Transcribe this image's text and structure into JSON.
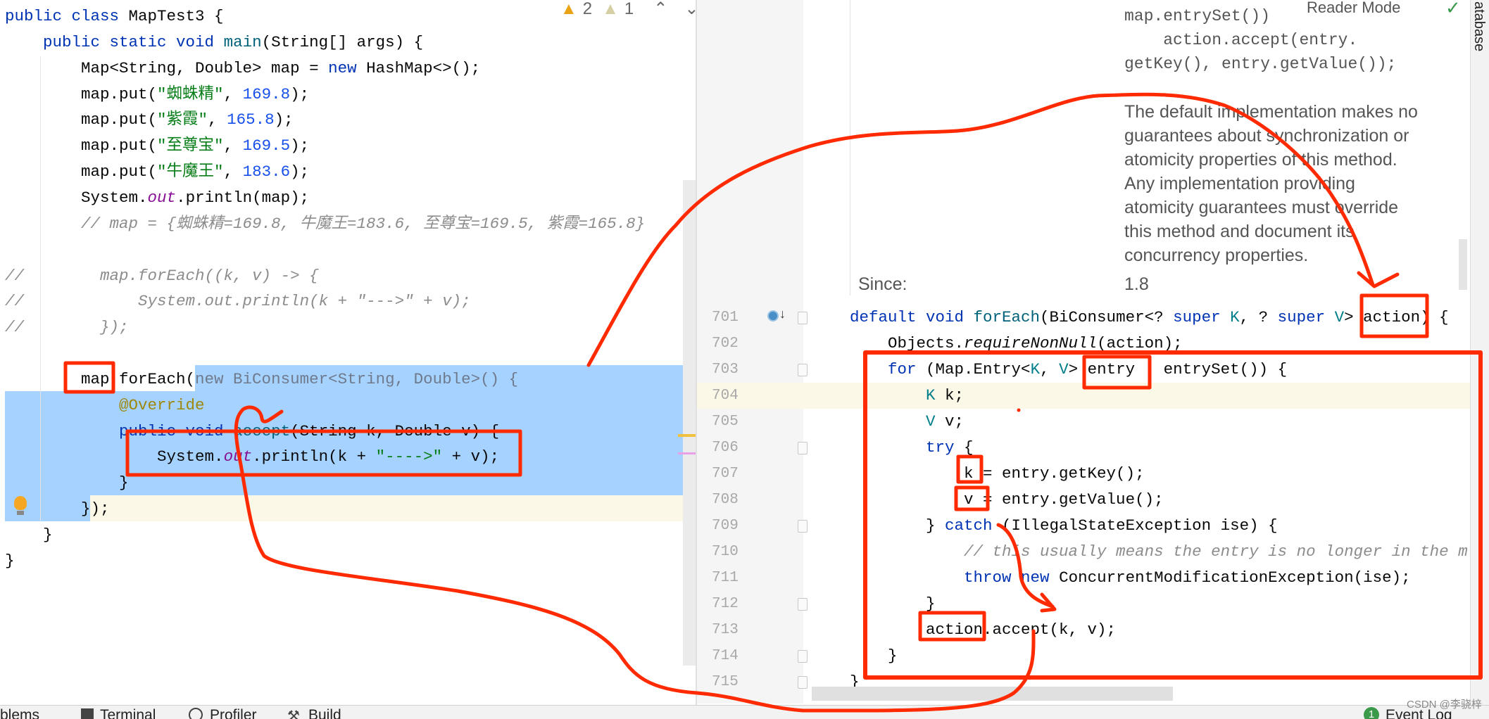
{
  "editor_left": {
    "inspection": {
      "warnings": "2",
      "weak_warnings": "1",
      "prev_icon": "chevron-up-icon",
      "next_icon": "chevron-down-icon"
    },
    "lines": [
      {
        "tokens": [
          [
            "public class ",
            "k"
          ],
          [
            "MapTest3 {",
            "p"
          ]
        ]
      },
      {
        "tokens": [
          [
            "    public static void ",
            "k"
          ],
          [
            "main",
            "m"
          ],
          [
            "(String[] args) {",
            "p"
          ]
        ]
      },
      {
        "tokens": [
          [
            "        Map<String, Double> map = ",
            "p"
          ],
          [
            "new ",
            "k"
          ],
          [
            "HashMap<>();",
            "p"
          ]
        ]
      },
      {
        "tokens": [
          [
            "        map.put(",
            "p"
          ],
          [
            "\"蜘蛛精\"",
            "s"
          ],
          [
            ", ",
            "p"
          ],
          [
            "169.8",
            "n"
          ],
          [
            ");",
            "p"
          ]
        ]
      },
      {
        "tokens": [
          [
            "        map.put(",
            "p"
          ],
          [
            "\"紫霞\"",
            "s"
          ],
          [
            ", ",
            "p"
          ],
          [
            "165.8",
            "n"
          ],
          [
            ");",
            "p"
          ]
        ]
      },
      {
        "tokens": [
          [
            "        map.put(",
            "p"
          ],
          [
            "\"至尊宝\"",
            "s"
          ],
          [
            ", ",
            "p"
          ],
          [
            "169.5",
            "n"
          ],
          [
            ");",
            "p"
          ]
        ]
      },
      {
        "tokens": [
          [
            "        map.put(",
            "p"
          ],
          [
            "\"牛魔王\"",
            "s"
          ],
          [
            ", ",
            "p"
          ],
          [
            "183.6",
            "n"
          ],
          [
            ");",
            "p"
          ]
        ]
      },
      {
        "tokens": [
          [
            "        System.",
            "p"
          ],
          [
            "out",
            "f"
          ],
          [
            ".println(map);",
            "p"
          ]
        ]
      },
      {
        "tokens": [
          [
            "        // map = {蜘蛛精=169.8, 牛魔王=183.6, 至尊宝=169.5, 紫霞=165.8}",
            "c"
          ]
        ]
      },
      {
        "tokens": []
      },
      {
        "tokens": [
          [
            "//        map.forEach((k, v) -> {",
            "c"
          ]
        ]
      },
      {
        "tokens": [
          [
            "//            System.out.println(k + \"--->\" + v);",
            "c"
          ]
        ]
      },
      {
        "tokens": [
          [
            "//        });",
            "c"
          ]
        ]
      },
      {
        "tokens": []
      },
      {
        "tokens": [
          [
            "        map.forEach(",
            "p"
          ],
          [
            "new BiConsumer<String, Double>() {",
            "g"
          ]
        ]
      },
      {
        "tokens": [
          [
            "            @Override",
            "a"
          ]
        ]
      },
      {
        "tokens": [
          [
            "            public void ",
            "k"
          ],
          [
            "accept",
            "m"
          ],
          [
            "(String k, Double v) {",
            "p"
          ]
        ]
      },
      {
        "tokens": [
          [
            "                System.",
            "p"
          ],
          [
            "out",
            "f"
          ],
          [
            ".println(k + ",
            "p"
          ],
          [
            "\"---->\"",
            "s"
          ],
          [
            " + v);",
            "p"
          ]
        ]
      },
      {
        "tokens": [
          [
            "            }",
            "p"
          ]
        ]
      },
      {
        "tokens": [
          [
            "        });",
            "p"
          ]
        ]
      },
      {
        "tokens": [
          [
            "    }",
            "p"
          ]
        ]
      },
      {
        "tokens": [
          [
            "}",
            "p"
          ]
        ]
      }
    ]
  },
  "doc_popup": {
    "reader_mode_label": "Reader Mode",
    "code_lines": [
      "map.entrySet())",
      "    action.accept(entry.",
      "getKey(), entry.getValue());"
    ],
    "paragraph_lines": [
      "The default implementation makes no",
      "guarantees about synchronization or",
      "atomicity properties of this method.",
      "Any implementation providing",
      "atomicity guarantees must override",
      "this method and document its",
      "concurrency properties."
    ],
    "since_label": "Since:",
    "since_value": "1.8"
  },
  "editor_right": {
    "lines": [
      {
        "num": "701",
        "tokens": [
          [
            "default void ",
            "k"
          ],
          [
            "forEach",
            "m"
          ],
          [
            "(BiConsumer<? ",
            "p"
          ],
          [
            "super ",
            "k"
          ],
          [
            "K",
            "t"
          ],
          [
            ", ? ",
            "p"
          ],
          [
            "super ",
            "k"
          ],
          [
            "V",
            "t"
          ],
          [
            "> action) {",
            "p"
          ]
        ]
      },
      {
        "num": "702",
        "tokens": [
          [
            "    Objects.",
            "p"
          ],
          [
            "requireNonNull",
            "i"
          ],
          [
            "(action);",
            "p"
          ]
        ]
      },
      {
        "num": "703",
        "tokens": [
          [
            "    for ",
            "k"
          ],
          [
            "(Map.Entry<",
            "p"
          ],
          [
            "K",
            "t"
          ],
          [
            ", ",
            "p"
          ],
          [
            "V",
            "t"
          ],
          [
            "> entry : entrySet()) {",
            "p"
          ]
        ]
      },
      {
        "num": "704",
        "tokens": [
          [
            "        K ",
            "t"
          ],
          [
            "k;",
            "p"
          ]
        ]
      },
      {
        "num": "705",
        "tokens": [
          [
            "        V ",
            "t"
          ],
          [
            "v;",
            "p"
          ]
        ]
      },
      {
        "num": "706",
        "tokens": [
          [
            "        try ",
            "k"
          ],
          [
            "{",
            "p"
          ]
        ]
      },
      {
        "num": "707",
        "tokens": [
          [
            "            k = entry.getKey();",
            "p"
          ]
        ]
      },
      {
        "num": "708",
        "tokens": [
          [
            "            v = entry.getValue();",
            "p"
          ]
        ]
      },
      {
        "num": "709",
        "tokens": [
          [
            "        } ",
            "p"
          ],
          [
            "catch ",
            "k"
          ],
          [
            "(IllegalStateException ise) {",
            "p"
          ]
        ]
      },
      {
        "num": "710",
        "tokens": [
          [
            "            // this usually means the entry is no longer in the m",
            "c"
          ]
        ]
      },
      {
        "num": "711",
        "tokens": [
          [
            "            throw new ",
            "k"
          ],
          [
            "ConcurrentModificationException(ise);",
            "p"
          ]
        ]
      },
      {
        "num": "712",
        "tokens": [
          [
            "        }",
            "p"
          ]
        ]
      },
      {
        "num": "713",
        "tokens": [
          [
            "        action.accept(k, v);",
            "p"
          ]
        ]
      },
      {
        "num": "714",
        "tokens": [
          [
            "    }",
            "p"
          ]
        ]
      },
      {
        "num": "715",
        "tokens": [
          [
            "}",
            "p"
          ]
        ]
      }
    ]
  },
  "side_tab": {
    "label": "atabase"
  },
  "bottom_bar": {
    "items": [
      {
        "label": "blems",
        "icon": "problems-icon"
      },
      {
        "label": "Terminal",
        "icon": "terminal-icon"
      },
      {
        "label": "Profiler",
        "icon": "profiler-icon"
      },
      {
        "label": "Build",
        "icon": "build-icon"
      }
    ],
    "event_log": {
      "label": "Event Log",
      "badge": "1"
    }
  },
  "watermark": "CSDN @李骁梓",
  "colors": {
    "annotation_red": "#ff2a00",
    "selection": "#a6d2ff",
    "current_line": "#fcf8e8",
    "keyword": "#0033b3",
    "string": "#067d17",
    "number": "#1750eb"
  }
}
